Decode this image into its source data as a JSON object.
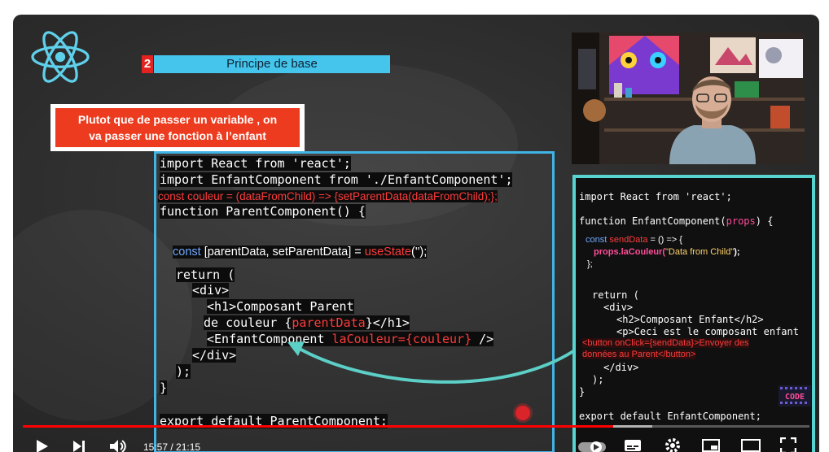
{
  "slide": {
    "number": "2",
    "title": "Principe de base",
    "note_line1": "Plutot que de passer un variable , on",
    "note_line2": "va passer une fonction à l’enfant"
  },
  "parent_code": {
    "l1": "import React from 'react';",
    "l2": "import EnfantComponent from './EnfantComponent';",
    "l3": "const couleur = (dataFromChild) => {setParentData(dataFromChild);};",
    "l4": "function ParentComponent() {",
    "l5_kw": "const",
    "l5_rest": " [parentData, setParentData] = ",
    "l5_fn": "useState",
    "l5_end": "('');",
    "l6": "return (",
    "l7": "<div>",
    "l8": "<h1>Composant Parent",
    "l9_a": "de couleur {",
    "l9_b": "parentData",
    "l9_c": "}</h1>",
    "l10_a": "<EnfantComponent ",
    "l10_b": "laCouleur={couleur}",
    "l10_c": " />",
    "l11": "</div>",
    "l12": ");",
    "l13": "}",
    "l14": "export default ParentComponent;"
  },
  "child_code": {
    "l1": "import React from 'react';",
    "l2_a": "function EnfantComponent(",
    "l2_b": "props",
    "l2_c": ") {",
    "l3_a": "const ",
    "l3_b": "sendData",
    "l3_c": " = () => {",
    "l4_a": "props.laCouleur(",
    "l4_b": "\"Data from Child\"",
    "l4_c": ");",
    "l5": "};",
    "l6": "return (",
    "l7": "<div>",
    "l8": "<h2>Composant Enfant</h2>",
    "l9": "<p>Ceci est le composant enfant",
    "l10": "<button onClick={sendData}>Envoyer des",
    "l11": "données au Parent</button>",
    "l12": "</div>",
    "l13": ");",
    "l14": "}",
    "l15": "export default EnfantComponent;"
  },
  "badge": {
    "text": "CODE"
  },
  "player": {
    "time": "15:57 / 21:15",
    "progress_fraction": 0.751,
    "buffer_fraction": 0.8,
    "icons": [
      "play-icon",
      "next-icon",
      "volume-icon",
      "autoplay-icon",
      "subtitles-icon",
      "settings-icon",
      "miniplayer-icon",
      "theater-icon",
      "fullscreen-icon"
    ]
  },
  "colors": {
    "accent_red": "#ff0000",
    "slide_title_bg": "#45c4ec",
    "parent_border": "#41b4e6",
    "child_border": "#58d4d0",
    "arrow": "#5ccfc6"
  }
}
